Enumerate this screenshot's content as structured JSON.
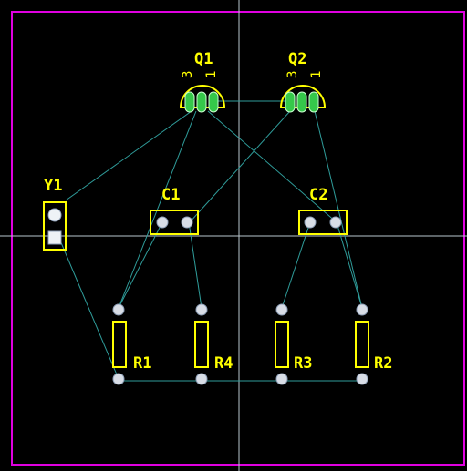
{
  "colors": {
    "background": "#000000",
    "board_outline": "#e000e0",
    "silkscreen": "#ffff00",
    "ratsnest": "#2f9c9a",
    "crosshair": "#b9c6ce",
    "pad": "#d8dde6",
    "transistor_pad": "#35c84a"
  },
  "components": {
    "q1": {
      "ref": "Q1",
      "pin3": "3",
      "pin1": "1"
    },
    "q2": {
      "ref": "Q2",
      "pin3": "3",
      "pin1": "1"
    },
    "y1": {
      "ref": "Y1"
    },
    "c1": {
      "ref": "C1"
    },
    "c2": {
      "ref": "C2"
    },
    "r1": {
      "ref": "R1"
    },
    "r4": {
      "ref": "R4"
    },
    "r3": {
      "ref": "R3"
    },
    "r2": {
      "ref": "R2"
    }
  }
}
